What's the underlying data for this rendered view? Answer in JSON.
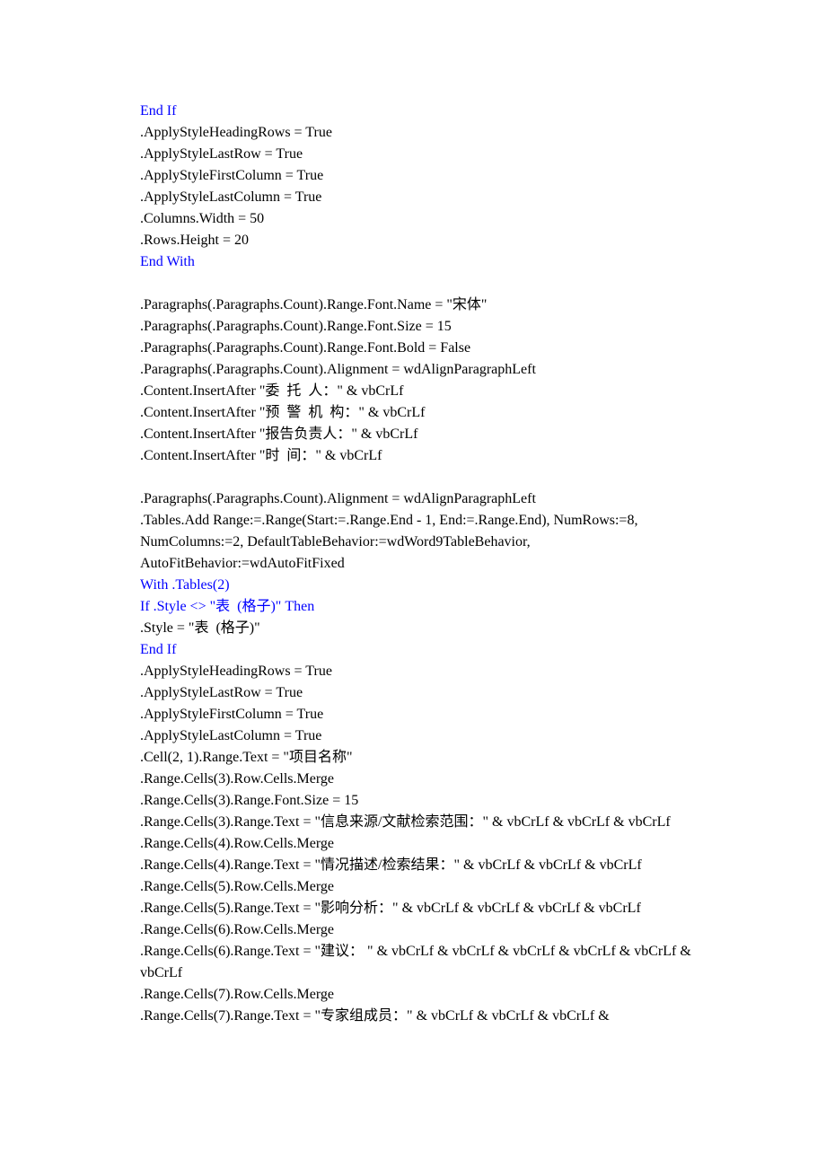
{
  "lines": [
    {
      "t": "End If",
      "c": "kw"
    },
    {
      "t": ".ApplyStyleHeadingRows = True",
      "c": "lit"
    },
    {
      "t": ".ApplyStyleLastRow = True",
      "c": "lit"
    },
    {
      "t": ".ApplyStyleFirstColumn = True",
      "c": "lit"
    },
    {
      "t": ".ApplyStyleLastColumn = True",
      "c": "lit"
    },
    {
      "t": ".Columns.Width = 50",
      "c": "lit"
    },
    {
      "t": ".Rows.Height = 20",
      "c": "lit"
    },
    {
      "t": "End With",
      "c": "kw"
    },
    {
      "t": "",
      "c": "blank"
    },
    {
      "t": ".Paragraphs(.Paragraphs.Count).Range.Font.Name = \"宋体\"",
      "c": "lit"
    },
    {
      "t": ".Paragraphs(.Paragraphs.Count).Range.Font.Size = 15",
      "c": "lit"
    },
    {
      "t": ".Paragraphs(.Paragraphs.Count).Range.Font.Bold = False",
      "c": "lit"
    },
    {
      "t": ".Paragraphs(.Paragraphs.Count).Alignment = wdAlignParagraphLeft",
      "c": "lit"
    },
    {
      "t": ".Content.InsertAfter \"委  托  人：\" & vbCrLf",
      "c": "lit"
    },
    {
      "t": ".Content.InsertAfter \"预  警  机  构：\" & vbCrLf",
      "c": "lit"
    },
    {
      "t": ".Content.InsertAfter \"报告负责人：\" & vbCrLf",
      "c": "lit"
    },
    {
      "t": ".Content.InsertAfter \"时  间：\" & vbCrLf",
      "c": "lit"
    },
    {
      "t": "",
      "c": "blank"
    },
    {
      "t": ".Paragraphs(.Paragraphs.Count).Alignment = wdAlignParagraphLeft",
      "c": "lit"
    },
    {
      "t": ".Tables.Add Range:=.Range(Start:=.Range.End - 1, End:=.Range.End), NumRows:=8, NumColumns:=2, DefaultTableBehavior:=wdWord9TableBehavior, AutoFitBehavior:=wdAutoFitFixed",
      "c": "lit"
    },
    {
      "t": "With .Tables(2)",
      "c": "kw"
    },
    {
      "t": "If .Style <> \"表  (格子)\" Then",
      "c": "kw"
    },
    {
      "t": ".Style = \"表  (格子)\"",
      "c": "lit"
    },
    {
      "t": "End If",
      "c": "kw"
    },
    {
      "t": ".ApplyStyleHeadingRows = True",
      "c": "lit"
    },
    {
      "t": ".ApplyStyleLastRow = True",
      "c": "lit"
    },
    {
      "t": ".ApplyStyleFirstColumn = True",
      "c": "lit"
    },
    {
      "t": ".ApplyStyleLastColumn = True",
      "c": "lit"
    },
    {
      "t": ".Cell(2, 1).Range.Text = \"项目名称\"",
      "c": "lit"
    },
    {
      "t": ".Range.Cells(3).Row.Cells.Merge",
      "c": "lit"
    },
    {
      "t": ".Range.Cells(3).Range.Font.Size = 15",
      "c": "lit"
    },
    {
      "t": ".Range.Cells(3).Range.Text = \"信息来源/文献检索范围：\" & vbCrLf & vbCrLf & vbCrLf",
      "c": "lit"
    },
    {
      "t": ".Range.Cells(4).Row.Cells.Merge",
      "c": "lit"
    },
    {
      "t": ".Range.Cells(4).Range.Text = \"情况描述/检索结果：\" & vbCrLf & vbCrLf & vbCrLf",
      "c": "lit"
    },
    {
      "t": ".Range.Cells(5).Row.Cells.Merge",
      "c": "lit"
    },
    {
      "t": ".Range.Cells(5).Range.Text = \"影响分析：\" & vbCrLf & vbCrLf & vbCrLf & vbCrLf",
      "c": "lit"
    },
    {
      "t": ".Range.Cells(6).Row.Cells.Merge",
      "c": "lit"
    },
    {
      "t": ".Range.Cells(6).Range.Text = \"建议： \" & vbCrLf & vbCrLf & vbCrLf & vbCrLf & vbCrLf & vbCrLf",
      "c": "lit"
    },
    {
      "t": ".Range.Cells(7).Row.Cells.Merge",
      "c": "lit"
    },
    {
      "t": ".Range.Cells(7).Range.Text = \"专家组成员：\" & vbCrLf & vbCrLf & vbCrLf &",
      "c": "lit"
    }
  ]
}
